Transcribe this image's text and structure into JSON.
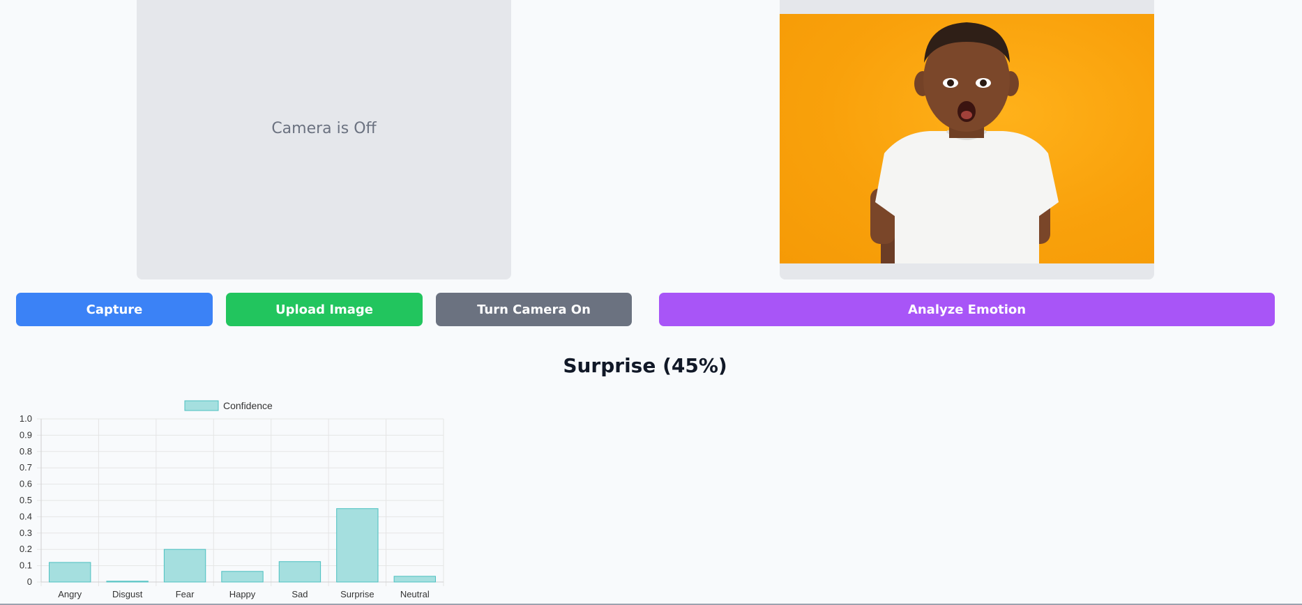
{
  "camera": {
    "status_text": "Camera is Off"
  },
  "buttons": {
    "capture": "Capture",
    "upload": "Upload Image",
    "camera_toggle": "Turn Camera On",
    "analyze": "Analyze Emotion"
  },
  "result": {
    "title": "Surprise (45%)"
  },
  "colors": {
    "capture": "#3b82f6",
    "upload": "#22c55e",
    "camera_toggle": "#6b7280",
    "analyze": "#a855f7",
    "bar_fill": "#a5dfdf",
    "bar_stroke": "#4bc0c0"
  },
  "chart_data": {
    "type": "bar",
    "categories": [
      "Angry",
      "Disgust",
      "Fear",
      "Happy",
      "Sad",
      "Surprise",
      "Neutral"
    ],
    "series": [
      {
        "name": "Confidence",
        "values": [
          0.12,
          0.005,
          0.2,
          0.065,
          0.125,
          0.45,
          0.035
        ]
      }
    ],
    "ylim": [
      0,
      1.0
    ],
    "yticks": [
      "0",
      "0.1",
      "0.2",
      "0.3",
      "0.4",
      "0.5",
      "0.6",
      "0.7",
      "0.8",
      "0.9",
      "1.0"
    ],
    "grid": true,
    "legend_position": "top-center"
  }
}
